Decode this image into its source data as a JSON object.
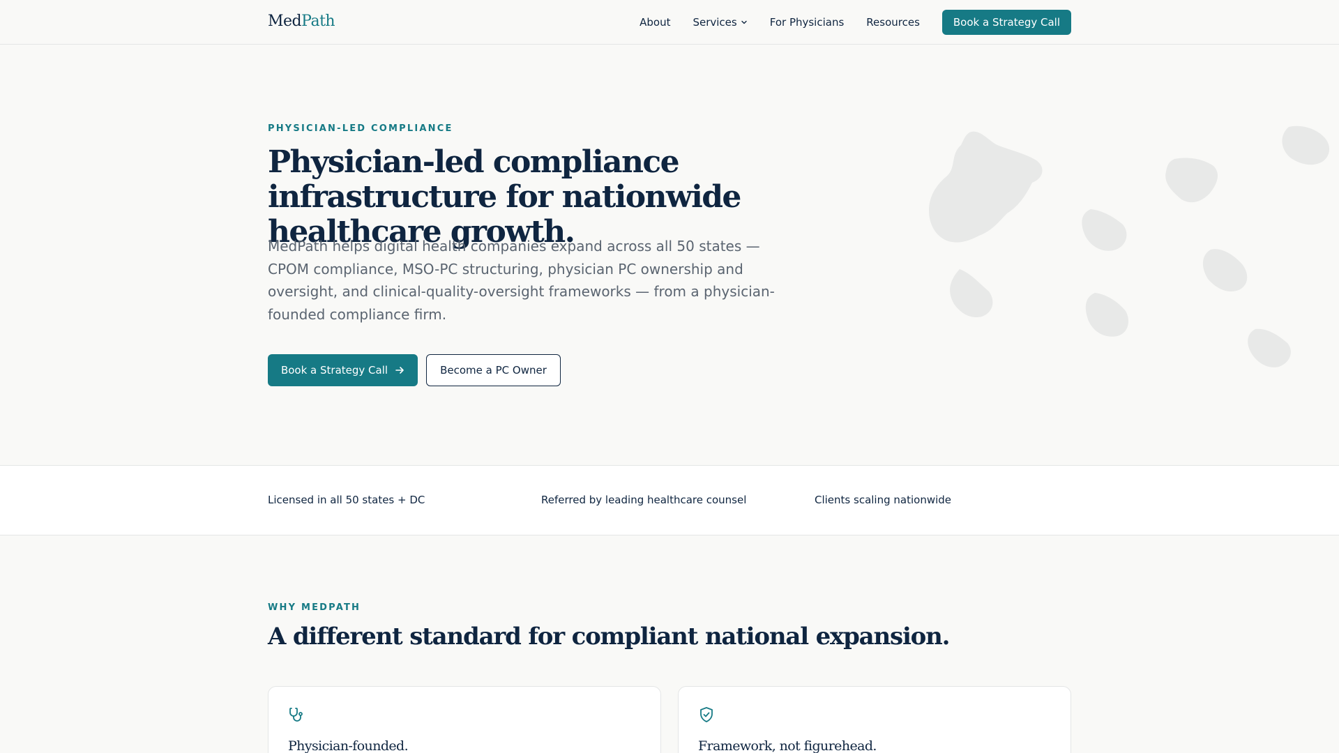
{
  "header": {
    "logo_part1": "Med",
    "logo_part2": "Path",
    "nav": [
      {
        "label": "About"
      },
      {
        "label": "Services"
      },
      {
        "label": "For Physicians"
      },
      {
        "label": "Resources"
      }
    ],
    "cta_label": "Book a Strategy Call"
  },
  "hero": {
    "eyebrow": "PHYSICIAN-LED COMPLIANCE",
    "title": "Physician-led compliance infrastructure for nationwide healthcare growth.",
    "subtitle": "MedPath helps digital health companies expand across all 50 states — CPOM compliance, MSO-PC structuring, physician PC ownership and oversight, and clinical-quality-oversight frameworks — from a physician-founded compliance firm.",
    "primary_button": "Book a Strategy Call",
    "secondary_button": "Become a PC Owner"
  },
  "trust": {
    "items": [
      "Licensed in all 50 states + DC",
      "Referred by leading healthcare counsel",
      "Clients scaling nationwide"
    ]
  },
  "why": {
    "eyebrow": "WHY MEDPATH",
    "title": "A different standard for compliant national expansion.",
    "cards": [
      {
        "icon": "stethoscope-icon",
        "title": "Physician-founded."
      },
      {
        "icon": "shield-check-icon",
        "title": "Framework, not figurehead."
      }
    ]
  },
  "colors": {
    "accent": "#167a85",
    "navy": "#0f2540",
    "background": "#f9f9f7",
    "muted_text": "#5a6470"
  }
}
